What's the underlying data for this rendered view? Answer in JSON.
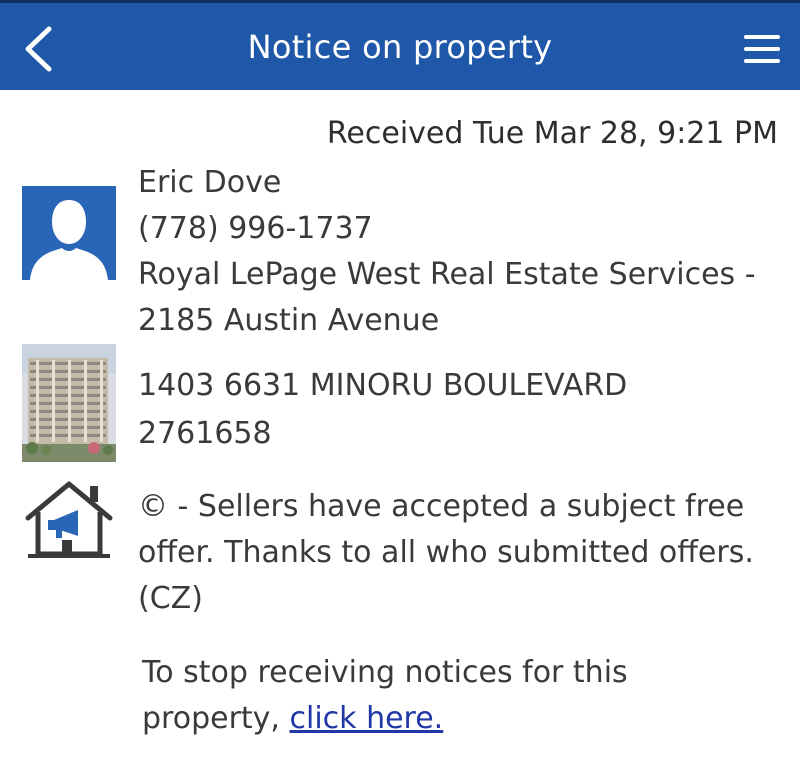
{
  "header": {
    "title": "Notice on property",
    "back_icon": "chevron-left-icon",
    "menu_icon": "hamburger-menu-icon",
    "background_color": "#1f58a8"
  },
  "received": "Received Tue Mar 28, 9:21 PM",
  "agent": {
    "avatar_icon": "person-silhouette-icon",
    "name": "Eric Dove",
    "phone": "(778) 996-1737",
    "brokerage_line1": "Royal LePage West Real Estate Services -",
    "brokerage_line2": "2185 Austin Avenue"
  },
  "property": {
    "photo_icon": "building-photo",
    "address": "1403 6631 MINORU BOULEVARD",
    "listing_number": "2761658"
  },
  "notice": {
    "icon": "house-megaphone-icon",
    "text": "© - Sellers have accepted a subject free offer. Thanks to all who submitted offers. (CZ)"
  },
  "unsubscribe": {
    "prefix": "To stop receiving notices for this property, ",
    "link_label": "click here."
  }
}
